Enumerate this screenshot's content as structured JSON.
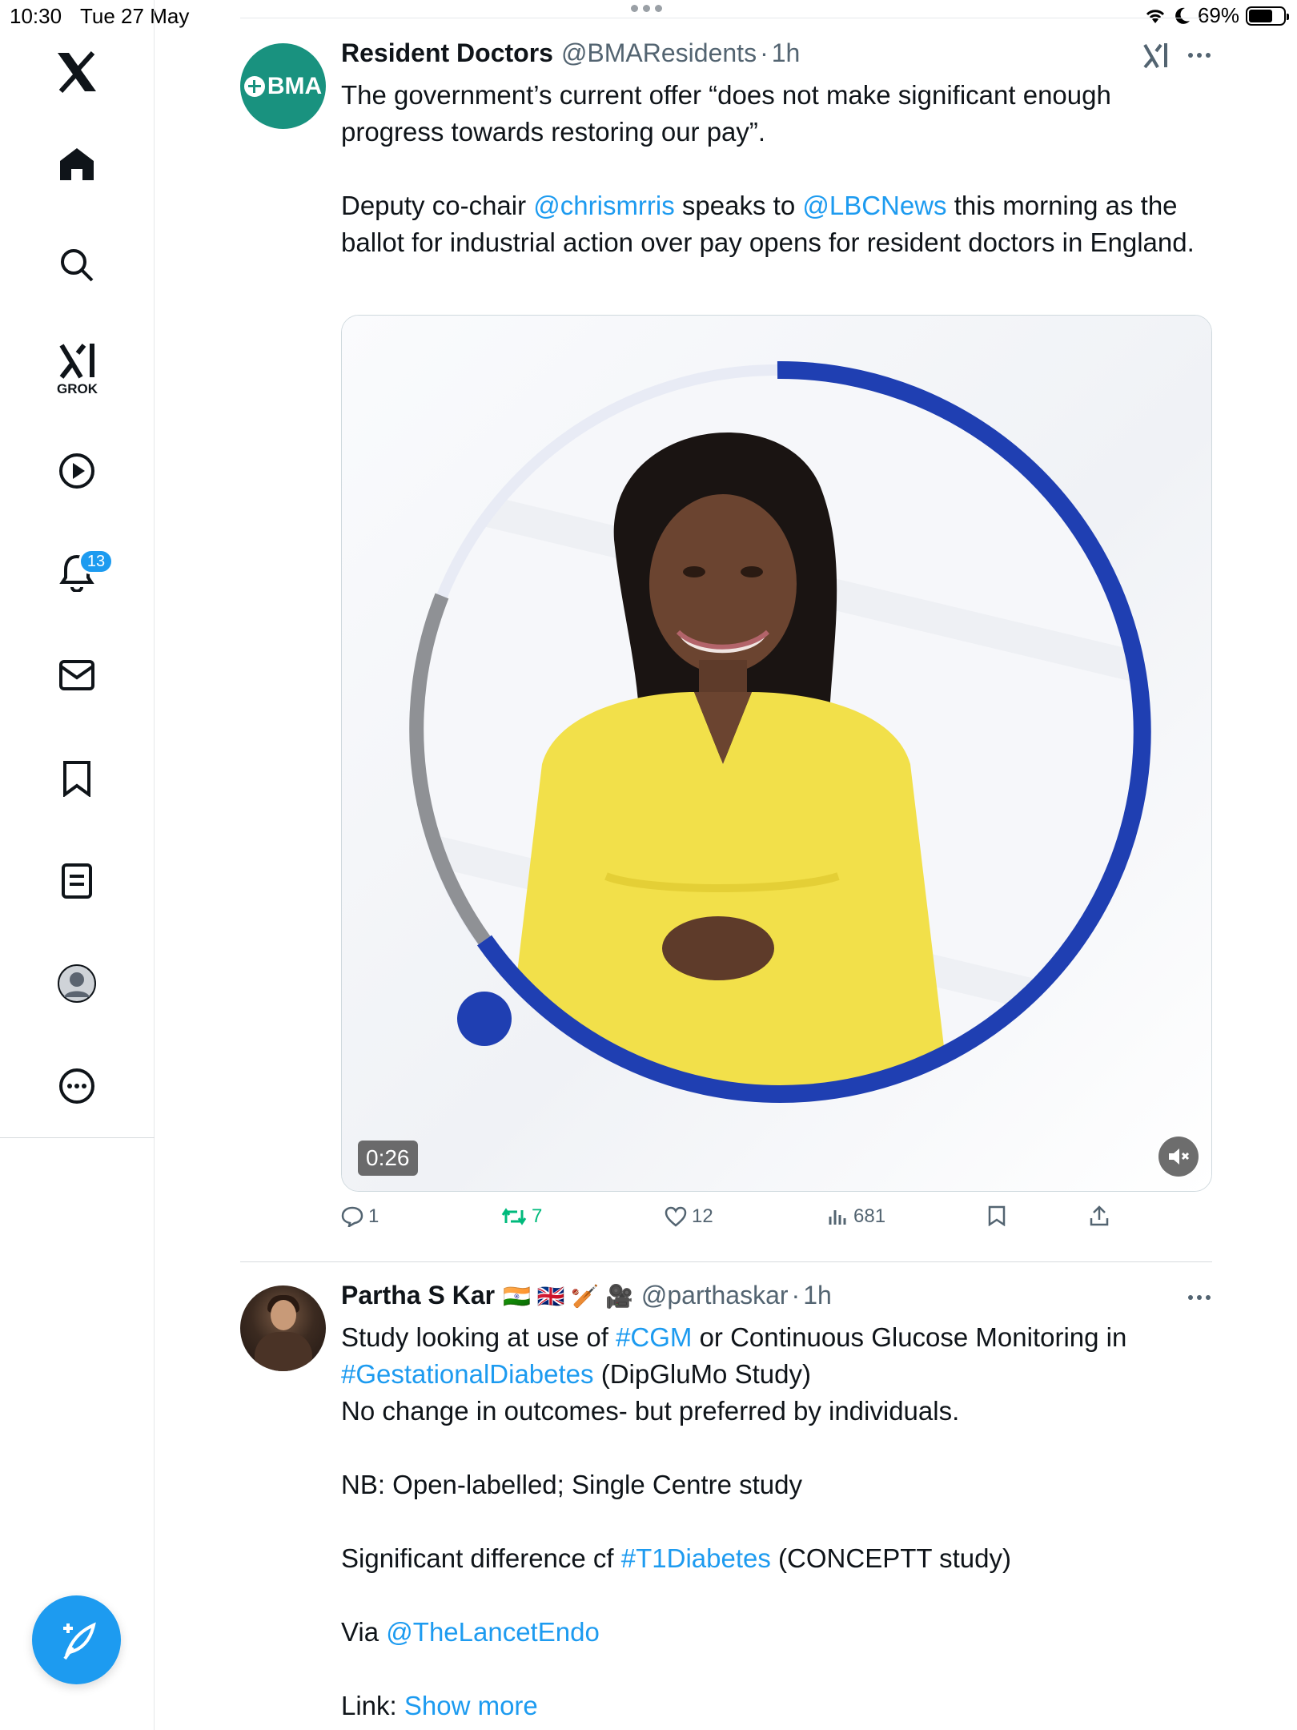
{
  "status_bar": {
    "time": "10:30",
    "date": "Tue 27 May",
    "battery": "69%"
  },
  "sidebar": {
    "items": [
      {
        "icon": "x-logo-icon"
      },
      {
        "icon": "home-icon"
      },
      {
        "icon": "search-icon"
      },
      {
        "icon": "grok-icon",
        "label": "GROK"
      },
      {
        "icon": "play-circle-icon"
      },
      {
        "icon": "bell-icon",
        "badge": "13"
      },
      {
        "icon": "mail-icon"
      },
      {
        "icon": "bookmark-icon"
      },
      {
        "icon": "list-icon"
      },
      {
        "icon": "profile-icon"
      },
      {
        "icon": "more-icon"
      }
    ],
    "compose_icon": "compose-feather-icon"
  },
  "tweets": [
    {
      "name": "Resident Doctors",
      "handle": "@BMAResidents",
      "separator": "·",
      "time": "1h",
      "avatar_text": "BMA",
      "text_line1": "The government’s current offer “does not make significant enough progress towards restoring our pay”.",
      "text_p2_a": "Deputy co-chair ",
      "text_p2_link1": "@chrismrris",
      "text_p2_b": " speaks to ",
      "text_p2_link2": "@LBCNews",
      "text_p2_c": " this morning as the ballot for industrial action over pay opens for resident doctors in England.",
      "video": {
        "duration": "0:26",
        "progress": 0.62
      },
      "stats": {
        "replies": "1",
        "retweets": "7",
        "likes": "12",
        "views": "681"
      }
    },
    {
      "name": "Partha S Kar",
      "flags": "🇮🇳 🇬🇧 🏏 🎥",
      "handle": "@parthaskar",
      "separator": "·",
      "time": "1h",
      "p1_a": "Study looking at use of ",
      "p1_link1": "#CGM",
      "p1_b": " or Continuous Glucose Monitoring in ",
      "p1_link2": "#GestationalDiabetes",
      "p1_c": " (DipGluMo Study)",
      "p1_line2": "No change in outcomes- but preferred by individuals.",
      "p2": "NB: Open-labelled; Single Centre study",
      "p3_a": "Significant difference cf ",
      "p3_link": "#T1Diabetes",
      "p3_b": " (CONCEPTT study)",
      "p4_a": "Via ",
      "p4_link": "@TheLancetEndo",
      "p5_a": "Link: ",
      "p5_link": "Show more"
    }
  ],
  "colors": {
    "accent": "#1d9bf0",
    "retweet": "#00ba7c",
    "bma_green": "#19927f",
    "progress_ring": "#1f3fb2"
  }
}
